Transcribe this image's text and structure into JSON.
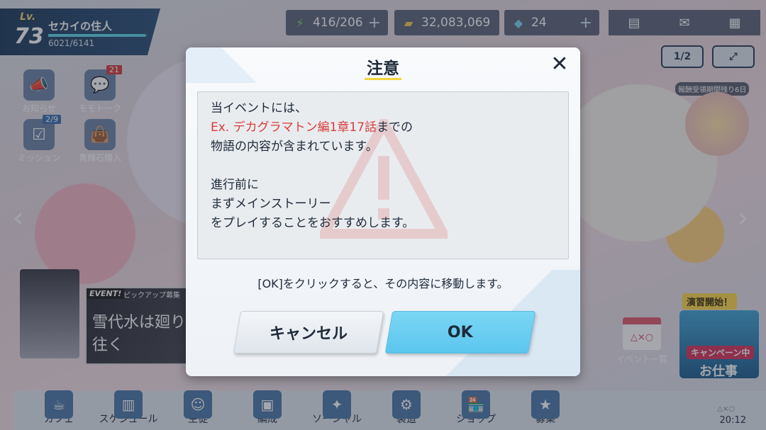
{
  "player": {
    "level_label": "Lv.",
    "level": "73",
    "name": "セカイの住人",
    "exp_text": "6021/6141",
    "exp_fraction": 0.98
  },
  "resources": {
    "energy": "416/206",
    "money": "32,083,069",
    "gems": "24"
  },
  "corner": {
    "page_indicator": "1/2"
  },
  "side_icons": [
    {
      "label": "お知らせ"
    },
    {
      "label": "モモトーク",
      "badge": "21"
    },
    {
      "label": "ミッション",
      "badge": "2/9"
    },
    {
      "label": "青輝石購入"
    }
  ],
  "right_panel": {
    "limited_text": "報酬受領期間残り6日",
    "event_list_label": "イベント一覧",
    "job_tag": "演習開始！",
    "job_campaign": "キャンペーン中",
    "job_title": "お仕事"
  },
  "event_banner": {
    "tag": "EVENT!",
    "sub": "ピックアップ募集",
    "title": "雪代水は廻り往く"
  },
  "bottom_nav": [
    {
      "label": "カフェ"
    },
    {
      "label": "スケジュール"
    },
    {
      "label": "生徒"
    },
    {
      "label": "編成"
    },
    {
      "label": "ソーシャル"
    },
    {
      "label": "製造"
    },
    {
      "label": "ショップ"
    },
    {
      "label": "募集"
    }
  ],
  "clock": "20:12",
  "modal": {
    "title": "注意",
    "message": {
      "line1": "当イベントには、",
      "line2_highlight": "Ex. デカグラマトン編1章17話",
      "line2_rest": "までの",
      "line3": "物語の内容が含まれています。",
      "line4": "進行前に",
      "line5": "まずメインストーリー",
      "line6": "をプレイすることをおすすめします。"
    },
    "hint": "[OK]をクリックすると、その内容に移動します。",
    "cancel_label": "キャンセル",
    "ok_label": "OK"
  },
  "colors": {
    "highlight": "#d93b3b",
    "ok_button": "#6fd0f2",
    "title_underline": "#f2d53c"
  }
}
